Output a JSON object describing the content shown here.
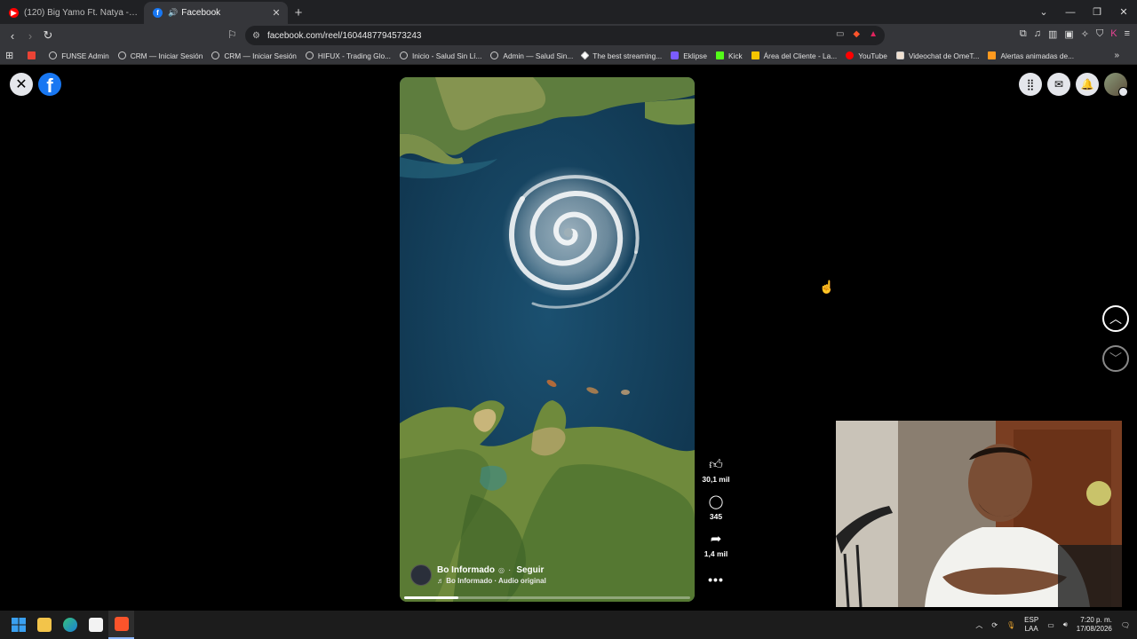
{
  "browser": {
    "tabs": [
      {
        "title": "(120) Big Yamo Ft. Natya - Tocarte To...",
        "favicon": "youtube-icon",
        "active": false
      },
      {
        "title": "Facebook",
        "favicon": "facebook-icon",
        "active": true,
        "audio": true
      }
    ],
    "url": "facebook.com/reel/1604487794573243",
    "bookmarks": [
      "FUNSE Admin",
      "CRM — Iniciar Sesión",
      "CRM — Iniciar Sesión",
      "HIFUX - Trading Glo...",
      "Inicio - Salud Sin Lí...",
      "Admin — Salud Sin...",
      "The best streaming...",
      "Eklipse",
      "Kick",
      "Área del Cliente - La...",
      "YouTube",
      "Videochat de OmeT...",
      "Alertas animadas de..."
    ]
  },
  "reel": {
    "author": "Bo Informado",
    "follow_label": "Seguir",
    "audio": "Bo Informado · Audio original",
    "likes": "30,1 mil",
    "comments": "345",
    "shares": "1,4 mil",
    "progress": 0.19
  },
  "taskbar": {
    "lang_1": "ESP",
    "lang_2": "LAA",
    "time": "7:20 p. m.",
    "date": "17/08/2026"
  },
  "colors": {
    "facebook_blue": "#1877f2",
    "ocean": "#123b55"
  }
}
